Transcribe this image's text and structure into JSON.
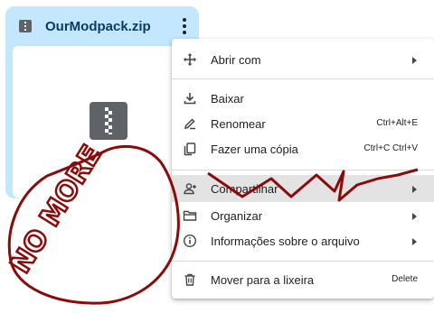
{
  "file": {
    "name": "OurModpack.zip",
    "icon": "zip-file-icon"
  },
  "menu": {
    "items": [
      {
        "label": "Abrir com",
        "icon": "open-with-icon",
        "shortcut": "",
        "submenu": true
      },
      {
        "label": "Baixar",
        "icon": "download-icon",
        "shortcut": "",
        "submenu": false
      },
      {
        "label": "Renomear",
        "icon": "rename-icon",
        "shortcut": "Ctrl+Alt+E",
        "submenu": false
      },
      {
        "label": "Fazer uma cópia",
        "icon": "copy-icon",
        "shortcut": "Ctrl+C Ctrl+V",
        "submenu": false
      },
      {
        "label": "Compartilhar",
        "icon": "share-person-icon",
        "shortcut": "",
        "submenu": true
      },
      {
        "label": "Organizar",
        "icon": "folder-icon",
        "shortcut": "",
        "submenu": true
      },
      {
        "label": "Informações sobre o arquivo",
        "icon": "info-icon",
        "shortcut": "",
        "submenu": true
      },
      {
        "label": "Mover para a lixeira",
        "icon": "trash-icon",
        "shortcut": "Delete",
        "submenu": false
      }
    ]
  },
  "annotation": {
    "text": "NO MORE",
    "color": "#8b0a0a"
  },
  "colors": {
    "card_bg": "#c2e7ff",
    "hover_bg": "#e3e3e3",
    "ink": "#8b0a0a"
  }
}
